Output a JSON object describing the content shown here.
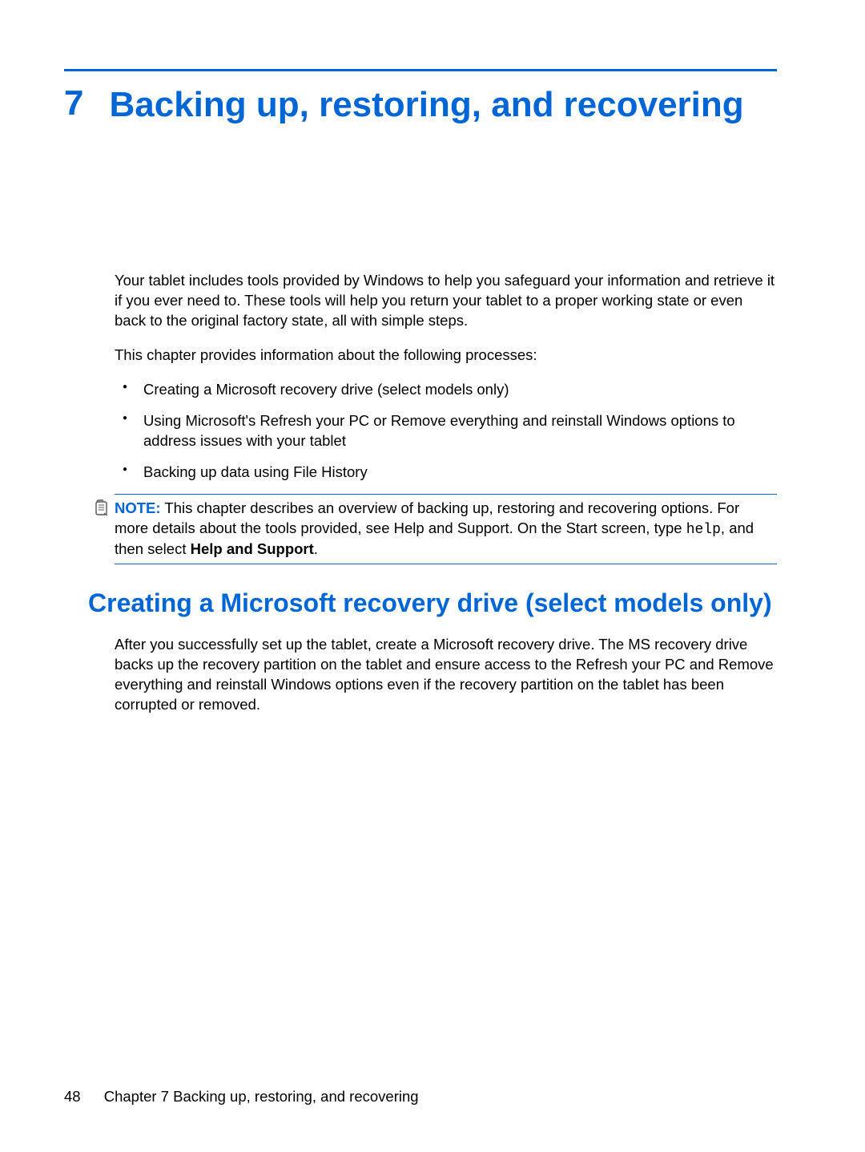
{
  "chapter": {
    "number": "7",
    "title": "Backing up, restoring, and recovering"
  },
  "intro": {
    "para1": "Your tablet includes tools provided by Windows to help you safeguard your information and retrieve it if you ever need to. These tools will help you return your tablet to a proper working state or even back to the original factory state, all with simple steps.",
    "para2": "This chapter provides information about the following processes:",
    "bullets": [
      "Creating a Microsoft recovery drive (select models only)",
      "Using Microsoft's Refresh your PC or Remove everything and reinstall Windows options to address issues with your tablet",
      "Backing up data using File History"
    ]
  },
  "note": {
    "label": "NOTE:",
    "text_before_mono": "This chapter describes an overview of backing up, restoring and recovering options. For more details about the tools provided, see Help and Support. On the Start screen, type ",
    "mono": "help",
    "text_after_mono": ", and then select ",
    "bold_end": "Help and Support",
    "period": "."
  },
  "section": {
    "heading": "Creating a Microsoft recovery drive (select models only)",
    "para": "After you successfully set up the tablet, create a Microsoft recovery drive. The MS recovery drive backs up the recovery partition on the tablet and ensure access to the Refresh your PC and Remove everything and reinstall Windows options even if the recovery partition on the tablet has been corrupted or removed."
  },
  "footer": {
    "page": "48",
    "text": "Chapter 7   Backing up, restoring, and recovering"
  }
}
